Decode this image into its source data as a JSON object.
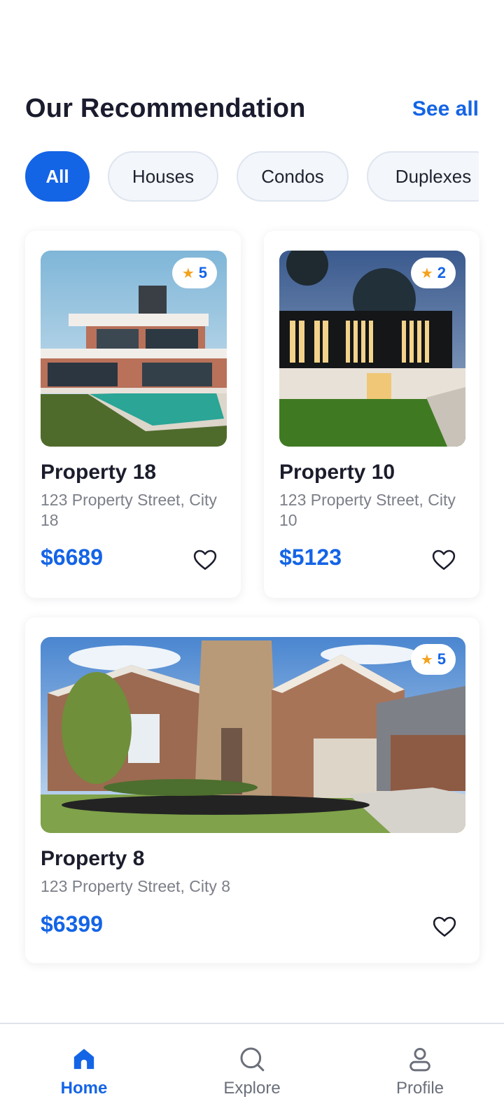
{
  "header": {
    "title": "Our Recommendation",
    "see_all": "See all"
  },
  "filters": [
    {
      "label": "All",
      "active": true
    },
    {
      "label": "Houses",
      "active": false
    },
    {
      "label": "Condos",
      "active": false
    },
    {
      "label": "Duplexes",
      "active": false
    }
  ],
  "properties": [
    {
      "title": "Property 18",
      "address": "123 Property Street, City 18",
      "price": "$6689",
      "rating": "5"
    },
    {
      "title": "Property 10",
      "address": "123 Property Street, City 10",
      "price": "$5123",
      "rating": "2"
    },
    {
      "title": "Property 8",
      "address": "123 Property Street, City 8",
      "price": "$6399",
      "rating": "5"
    }
  ],
  "nav": [
    {
      "label": "Home",
      "icon": "home-icon",
      "active": true
    },
    {
      "label": "Explore",
      "icon": "search-icon",
      "active": false
    },
    {
      "label": "Profile",
      "icon": "user-icon",
      "active": false
    }
  ],
  "colors": {
    "accent": "#1464e6",
    "star": "#f4a21d",
    "text": "#1b1d2c",
    "muted": "#7c7f88"
  }
}
